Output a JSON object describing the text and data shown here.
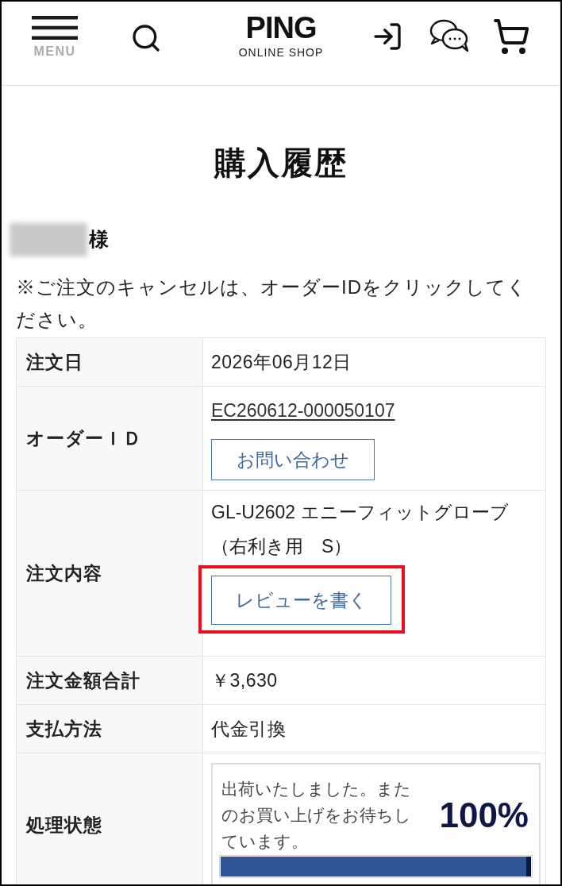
{
  "header": {
    "menu_label": "MENU",
    "logo": {
      "wordmark": "PING",
      "subtitle": "ONLINE SHOP"
    }
  },
  "page_title": "購入履歴",
  "customer": {
    "honorific": "様"
  },
  "notice": "※ご注文のキャンセルは、オーダーIDをクリックしてください。",
  "order_table": {
    "rows": [
      {
        "kind": "text",
        "label": "注文日",
        "value": "2026年06月12日"
      },
      {
        "kind": "order_id",
        "label": "オーダーＩＤ",
        "link": "EC260612-000050107",
        "button": "お問い合わせ"
      },
      {
        "kind": "product",
        "label": "注文内容",
        "product": "GL-U2602 エニーフィットグローブ（右利き用　S）",
        "button": "レビューを書く",
        "highlighted": true
      },
      {
        "kind": "text",
        "label": "注文金額合計",
        "value": "￥3,630"
      },
      {
        "kind": "text",
        "label": "支払方法",
        "value": "代金引換"
      },
      {
        "kind": "status",
        "label": "処理状態",
        "message": "出荷いたしました。またのお買い上げをお待ちしています。",
        "percent": "100%",
        "level": 1
      }
    ]
  }
}
